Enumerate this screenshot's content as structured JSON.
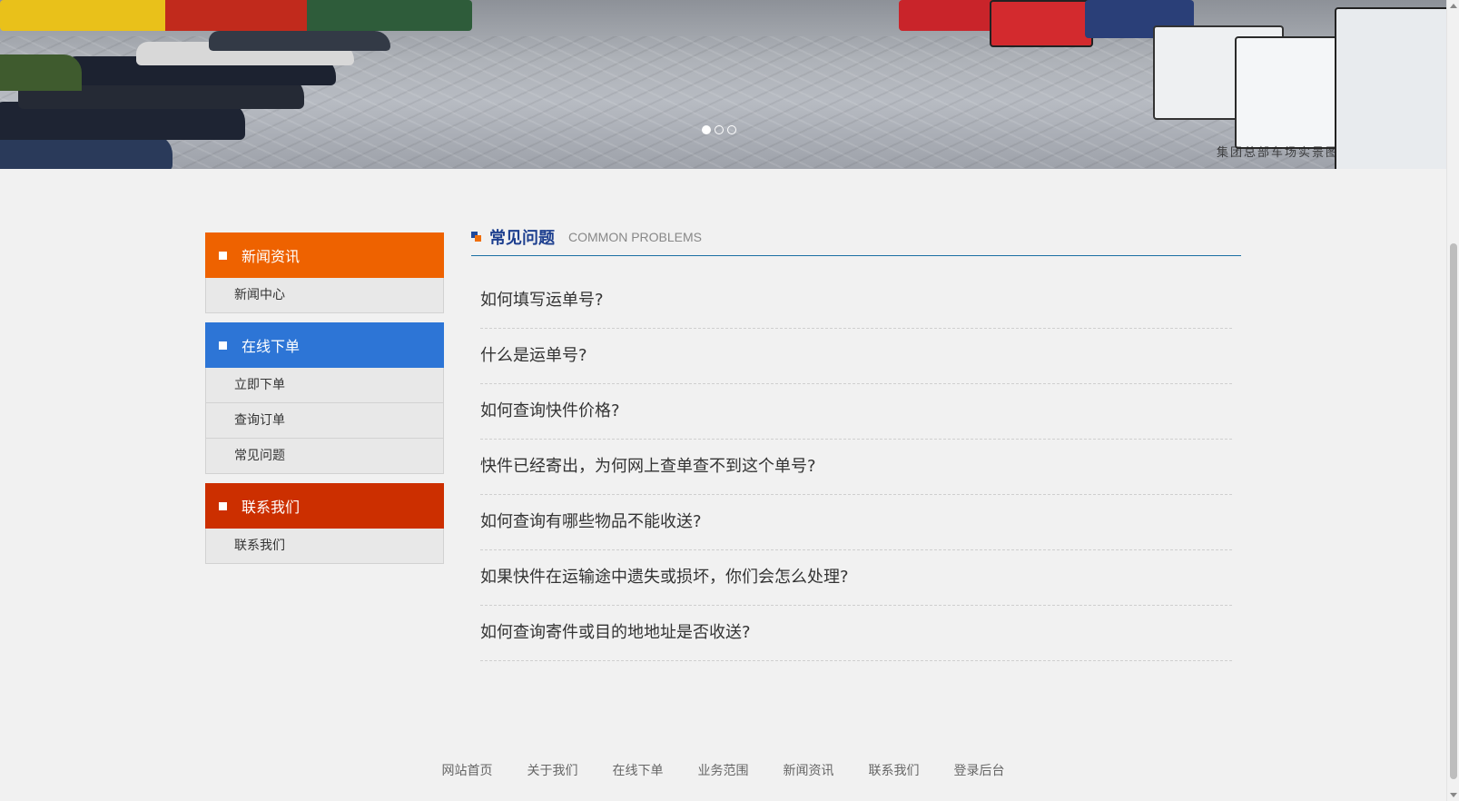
{
  "banner": {
    "caption": "集团总部车场实景图",
    "slides": [
      "slide-1",
      "slide-2",
      "slide-3"
    ],
    "active_slide": 0
  },
  "sidebar": {
    "groups": [
      {
        "title": "新闻资讯",
        "color": "#ee6200",
        "items": [
          "新闻中心"
        ]
      },
      {
        "title": "在线下单",
        "color": "#2d75d6",
        "items": [
          "立即下单",
          "查询订单",
          "常见问题"
        ]
      },
      {
        "title": "联系我们",
        "color": "#cc2f00",
        "items": [
          "联系我们"
        ]
      }
    ]
  },
  "main": {
    "title_cn": "常见问题",
    "title_en": "COMMON PROBLEMS",
    "faqs": [
      "如何填写运单号?",
      "什么是运单号?",
      "如何查询快件价格?",
      "快件已经寄出，为何网上查单查不到这个单号?",
      "如何查询有哪些物品不能收送?",
      "如果快件在运输途中遗失或损坏，你们会怎么处理?",
      "如何查询寄件或目的地地址是否收送?"
    ]
  },
  "footer": {
    "links": [
      "网站首页",
      "关于我们",
      "在线下单",
      "业务范围",
      "新闻资讯",
      "联系我们",
      "登录后台"
    ]
  },
  "colors": {
    "accent_blue": "#1d3f8f",
    "accent_orange": "#f06e0b",
    "divider": "#1b6fa3",
    "background": "#f1f1f1"
  }
}
